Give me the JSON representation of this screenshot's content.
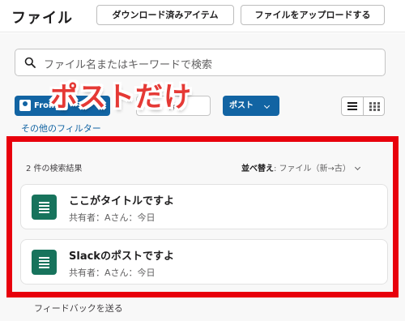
{
  "header": {
    "title": "ファイル",
    "downloaded_label": "ダウンロード済みアイテム",
    "upload_label": "ファイルをアップロードする"
  },
  "search": {
    "placeholder": "ファイル名またはキーワードで検索"
  },
  "filters": {
    "from_label": "From",
    "type_label": "Type",
    "post_label": "ポスト",
    "other_filters_label": "その他のフィルター"
  },
  "annotation": {
    "text": "ポストだけ",
    "color": "#e53935"
  },
  "results": {
    "count_label": "2 件の検索結果",
    "sort_prefix": "並べ替え",
    "sort_value": ": ファイル（新→古）",
    "items": [
      {
        "name": "ここがタイトルですよ",
        "meta": "共有者：Aさん：今日"
      },
      {
        "name": "Slackのポストですよ",
        "meta": "共有者：Aさん：今日"
      }
    ]
  },
  "footer": {
    "feedback_label": "フィードバックを送る"
  },
  "colors": {
    "accent": "#1264a3",
    "highlight_border": "#e8000c",
    "file_icon": "#17735c"
  }
}
